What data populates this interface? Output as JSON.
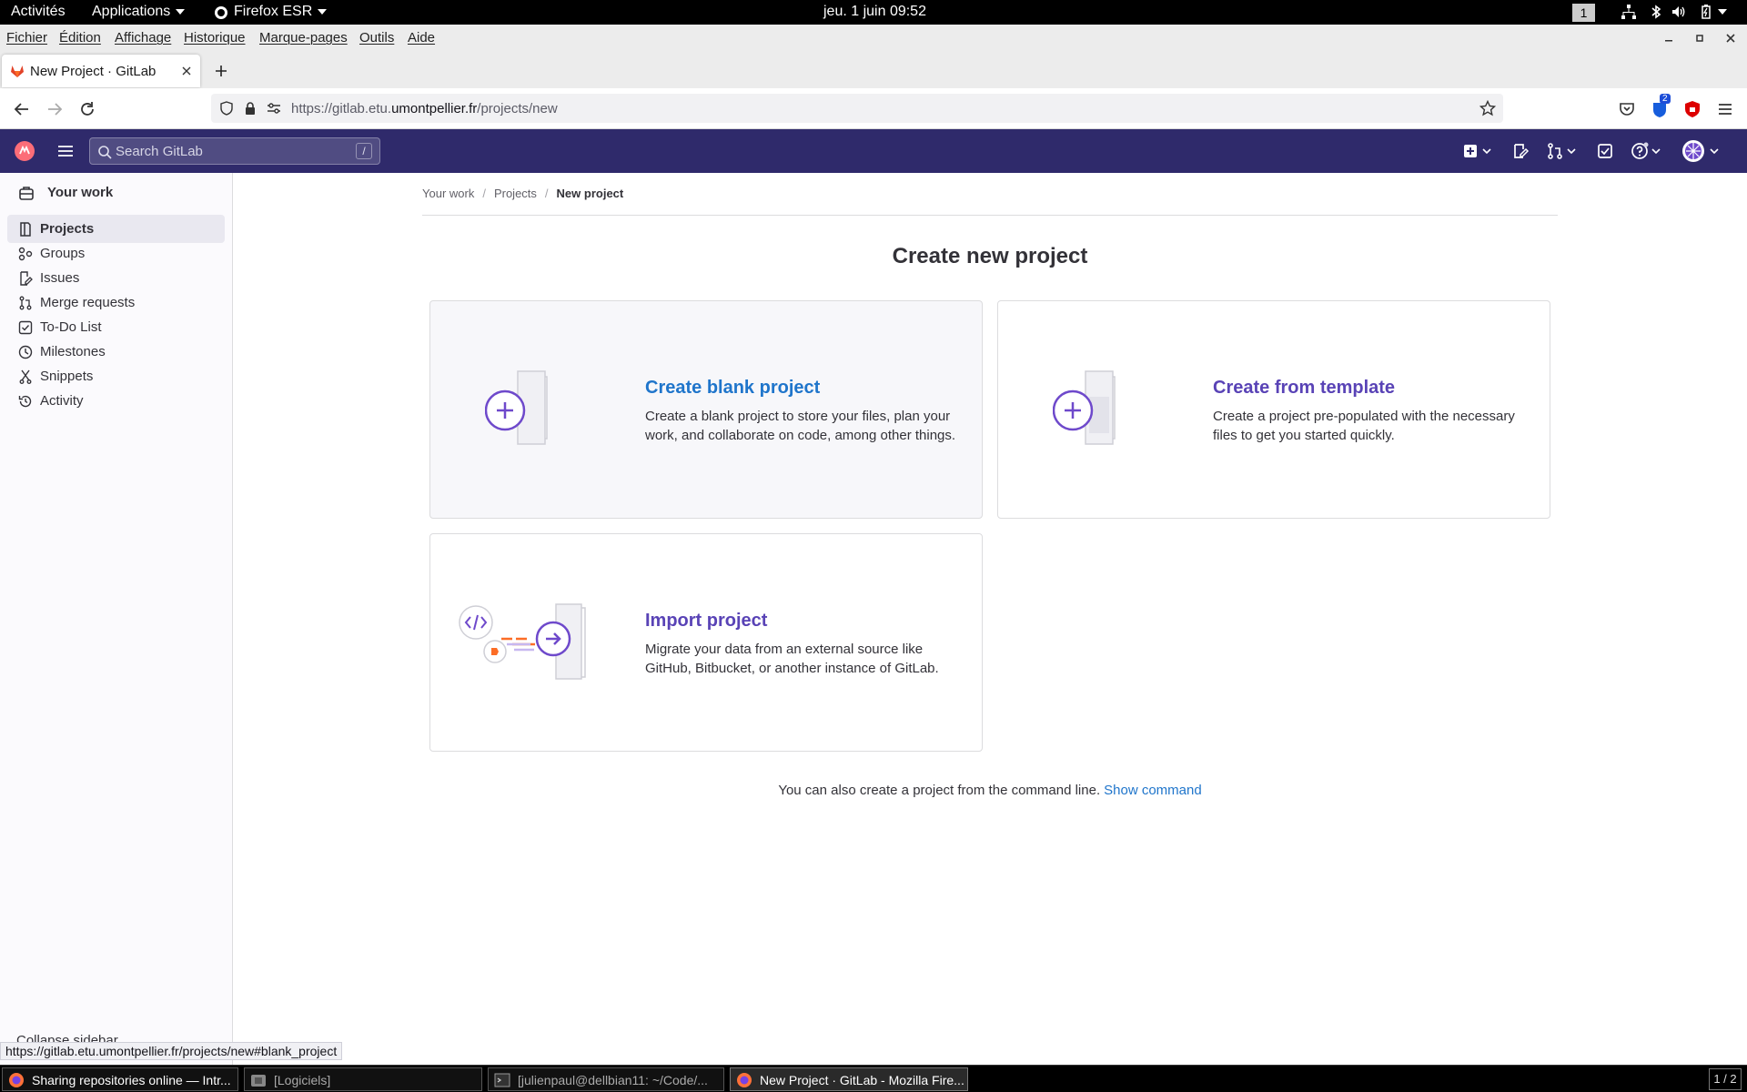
{
  "desktop": {
    "activities": "Activités",
    "applications": "Applications",
    "browser_menu": "Firefox ESR",
    "clock": "jeu. 1 juin  09:52",
    "workspace": "1"
  },
  "browser": {
    "menu": [
      "Fichier",
      "Édition",
      "Affichage",
      "Historique",
      "Marque-pages",
      "Outils",
      "Aide"
    ],
    "tab_title": "New Project · GitLab",
    "url_prefix": "https://gitlab.etu.",
    "url_host": "umontpellier.fr",
    "url_path": "/projects/new",
    "status_url": "https://gitlab.etu.umontpellier.fr/projects/new#blank_project",
    "ext_badge": "2"
  },
  "gitlab": {
    "search_placeholder": "Search GitLab",
    "search_shortcut": "/",
    "sidebar": {
      "title": "Your work",
      "items": [
        {
          "label": "Projects",
          "icon": "project-icon"
        },
        {
          "label": "Groups",
          "icon": "group-icon"
        },
        {
          "label": "Issues",
          "icon": "issues-icon"
        },
        {
          "label": "Merge requests",
          "icon": "merge-request-icon"
        },
        {
          "label": "To-Do List",
          "icon": "todo-icon"
        },
        {
          "label": "Milestones",
          "icon": "milestone-icon"
        },
        {
          "label": "Snippets",
          "icon": "snippet-icon"
        },
        {
          "label": "Activity",
          "icon": "history-icon"
        }
      ],
      "collapse": "Collapse sidebar"
    },
    "breadcrumb": [
      "Your work",
      "Projects",
      "New project"
    ],
    "page_title": "Create new project",
    "panels": {
      "blank": {
        "title": "Create blank project",
        "desc": "Create a blank project to store your files, plan your work, and collaborate on code, among other things."
      },
      "template": {
        "title": "Create from template",
        "desc": "Create a project pre-populated with the necessary files to get you started quickly."
      },
      "import": {
        "title": "Import project",
        "desc": "Migrate your data from an external source like GitHub, Bitbucket, or another instance of GitLab."
      }
    },
    "cli_note": "You can also create a project from the command line.",
    "cli_link": "Show command"
  },
  "taskbar": {
    "tasks": [
      "Sharing repositories online — Intr...",
      "[Logiciels]",
      "[julienpaul@dellbian11: ~/Code/...",
      "New Project · GitLab - Mozilla Fire..."
    ],
    "pager": "1 / 2"
  }
}
